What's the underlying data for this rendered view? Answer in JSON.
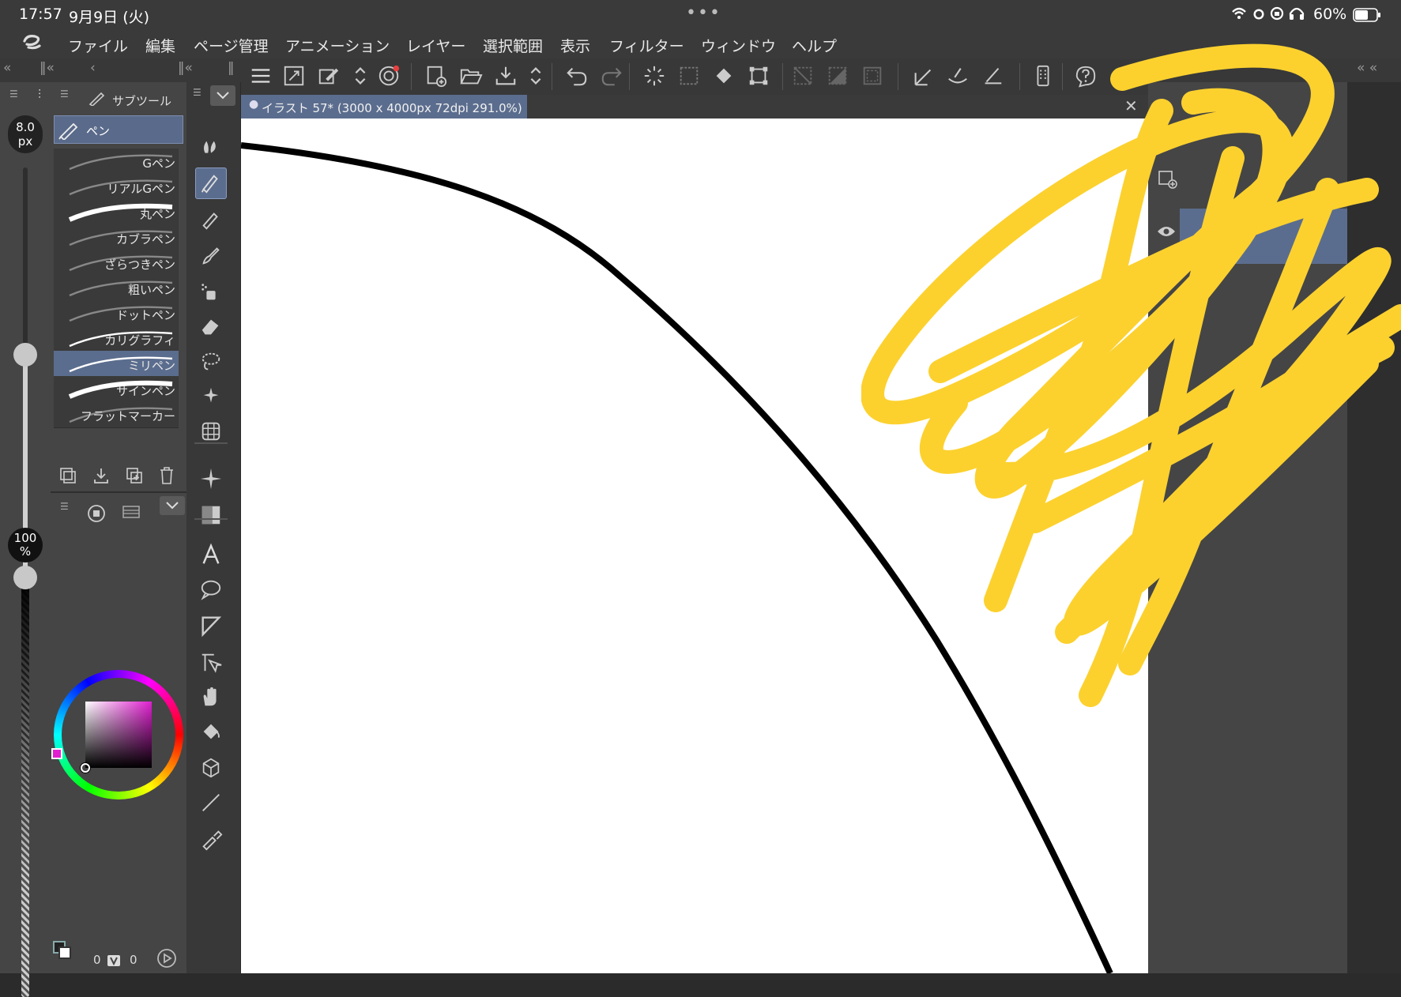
{
  "status": {
    "time": "17:57",
    "date": "9月9日 (火)",
    "battery": "60%",
    "dots": "•••"
  },
  "menu": {
    "items": [
      "ファイル",
      "編集",
      "ページ管理",
      "アニメーション",
      "レイヤー",
      "選択範囲",
      "表示",
      "フィルター",
      "ウィンドウ",
      "ヘルプ"
    ]
  },
  "brush_size": {
    "value": "8.0",
    "unit": "px"
  },
  "opacity": {
    "value": "100",
    "unit": "%"
  },
  "subtool": {
    "tab_label": "サブツール",
    "group_label": "ペン",
    "items": [
      "Gペン",
      "リアルGペン",
      "丸ペン",
      "カブラペン",
      "ざらつきペン",
      "粗いペン",
      "ドットペン",
      "カリグラフィ",
      "ミリペン",
      "サインペン",
      "フラットマーカー"
    ],
    "selected": "ミリペン"
  },
  "canvas": {
    "tab_title": "イラスト 57* (3000 x 4000px 72dpi 291.0%)"
  },
  "bottom_status": {
    "a": "0",
    "b": "0"
  },
  "colors": {
    "accent_yellow": "#fcd12e",
    "menubar": "#3a3a3a",
    "panel": "#454545"
  }
}
